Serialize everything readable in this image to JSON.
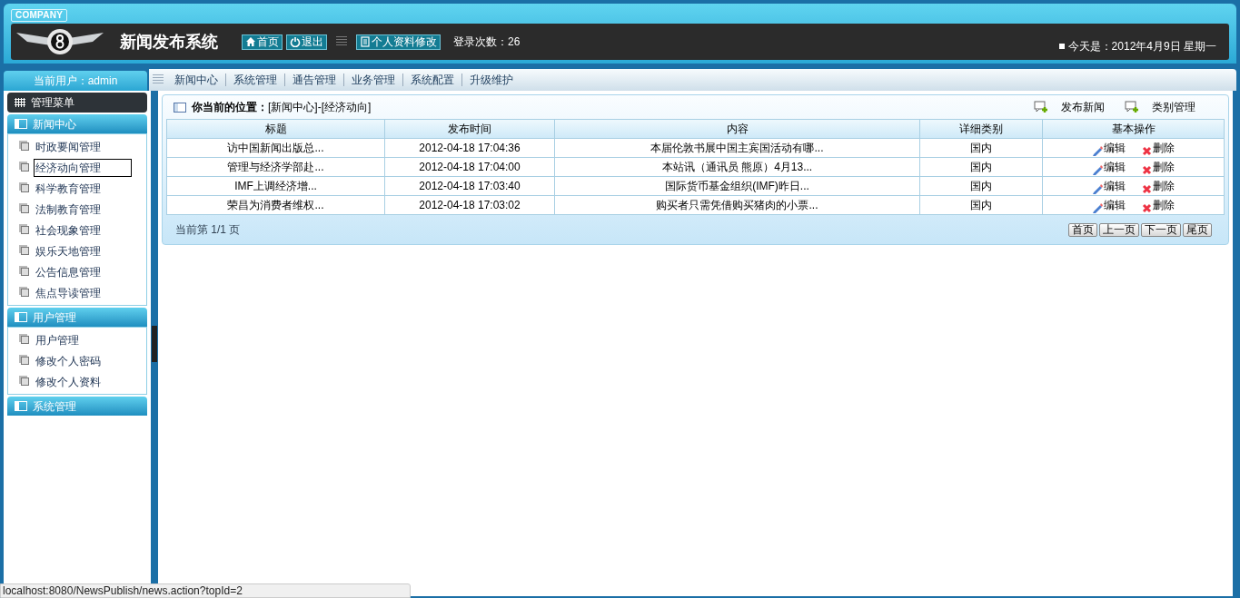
{
  "header": {
    "company": "COMPANY",
    "title": "新闻发布系统",
    "buttons": [
      {
        "kind": "home",
        "label": "首页"
      },
      {
        "kind": "power",
        "label": "退出"
      },
      {
        "kind": "doc",
        "label": "个人资料修改"
      }
    ],
    "login_count": "登录次数：26",
    "date": "今天是：2012年4月9日 星期一"
  },
  "current_user": "当前用户：admin",
  "top_menu": [
    "新闻中心",
    "系统管理",
    "通告管理",
    "业务管理",
    "系统配置",
    "升级维护"
  ],
  "sidebar": {
    "title": "管理菜单",
    "groups": [
      {
        "label": "新闻中心",
        "expanded": true,
        "items": [
          {
            "label": "时政要闻管理",
            "selected": false
          },
          {
            "label": "经济动向管理",
            "selected": true
          },
          {
            "label": "科学教育管理",
            "selected": false
          },
          {
            "label": "法制教育管理",
            "selected": false
          },
          {
            "label": "社会现象管理",
            "selected": false
          },
          {
            "label": "娱乐天地管理",
            "selected": false
          },
          {
            "label": "公告信息管理",
            "selected": false
          },
          {
            "label": "焦点导读管理",
            "selected": false
          }
        ]
      },
      {
        "label": "用户管理",
        "expanded": true,
        "items": [
          {
            "label": "用户管理",
            "selected": false
          },
          {
            "label": "修改个人密码",
            "selected": false
          },
          {
            "label": "修改个人资料",
            "selected": false
          }
        ]
      },
      {
        "label": "系统管理",
        "expanded": false
      }
    ]
  },
  "main": {
    "location_label": "你当前的位置：",
    "location": "[新闻中心]-[经济动向]",
    "actions": [
      "发布新闻",
      "类别管理"
    ],
    "table": {
      "columns": [
        "标题",
        "发布时间",
        "内容",
        "详细类别",
        "基本操作"
      ],
      "rows": [
        {
          "title": "访中国新闻出版总...",
          "time": "2012-04-18 17:04:36",
          "content": "本届伦敦书展中国主宾国活动有哪...",
          "category": "国内",
          "edit": "编辑",
          "delete": "删除"
        },
        {
          "title": "管理与经济学部赴...",
          "time": "2012-04-18 17:04:00",
          "content": "本站讯（通讯员 熊原）4月13...",
          "category": "国内",
          "edit": "编辑",
          "delete": "删除"
        },
        {
          "title": "IMF上调经济增...",
          "time": "2012-04-18 17:03:40",
          "content": "国际货币基金组织(IMF)昨日...",
          "category": "国内",
          "edit": "编辑",
          "delete": "删除"
        },
        {
          "title": "荣昌为消费者维权...",
          "time": "2012-04-18 17:03:02",
          "content": "购买者只需凭借购买猪肉的小票...",
          "category": "国内",
          "edit": "编辑",
          "delete": "删除"
        }
      ]
    },
    "page_info": "当前第 1/1 页",
    "pager": [
      "首页",
      "上一页",
      "下一页",
      "尾页"
    ]
  },
  "status_bar": "localhost:8080/NewsPublish/news.action?topId=2"
}
